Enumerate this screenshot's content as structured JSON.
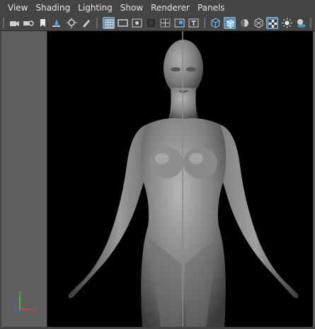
{
  "menu": [
    "View",
    "Shading",
    "Lighting",
    "Show",
    "Renderer",
    "Panels"
  ],
  "toolbar": {
    "items": [
      {
        "name": "camera-select-icon",
        "active": false
      },
      {
        "name": "camera-attributes-icon",
        "active": false
      },
      {
        "name": "bookmark-icon",
        "active": false
      },
      {
        "name": "image-plane-icon",
        "active": false
      },
      {
        "name": "2d-pan-zoom-icon",
        "active": false
      },
      {
        "name": "grease-pencil-icon",
        "active": false
      },
      {
        "name": "grid-icon",
        "active": true
      },
      {
        "name": "film-gate-icon",
        "active": false
      },
      {
        "name": "resolution-gate-icon",
        "active": false
      },
      {
        "name": "gate-mask-icon",
        "active": false
      },
      {
        "name": "field-chart-icon",
        "active": false
      },
      {
        "name": "safe-action-icon",
        "active": false
      },
      {
        "name": "safe-title-icon",
        "active": false
      },
      {
        "name": "wireframe-icon",
        "active": false
      },
      {
        "name": "smooth-shade-icon",
        "active": true
      },
      {
        "name": "default-material-icon",
        "active": false
      },
      {
        "name": "xray-icon",
        "active": false
      },
      {
        "name": "textured-icon",
        "active": true
      },
      {
        "name": "use-all-lights-icon",
        "active": false
      },
      {
        "name": "shadows-icon",
        "active": false
      }
    ]
  },
  "axis": {
    "x": "x",
    "y": "y",
    "z": "z"
  },
  "colors": {
    "x_axis": "#e04040",
    "y_axis": "#40d040",
    "z_axis": "#4a6cff",
    "active_button": "#5d86a8"
  }
}
